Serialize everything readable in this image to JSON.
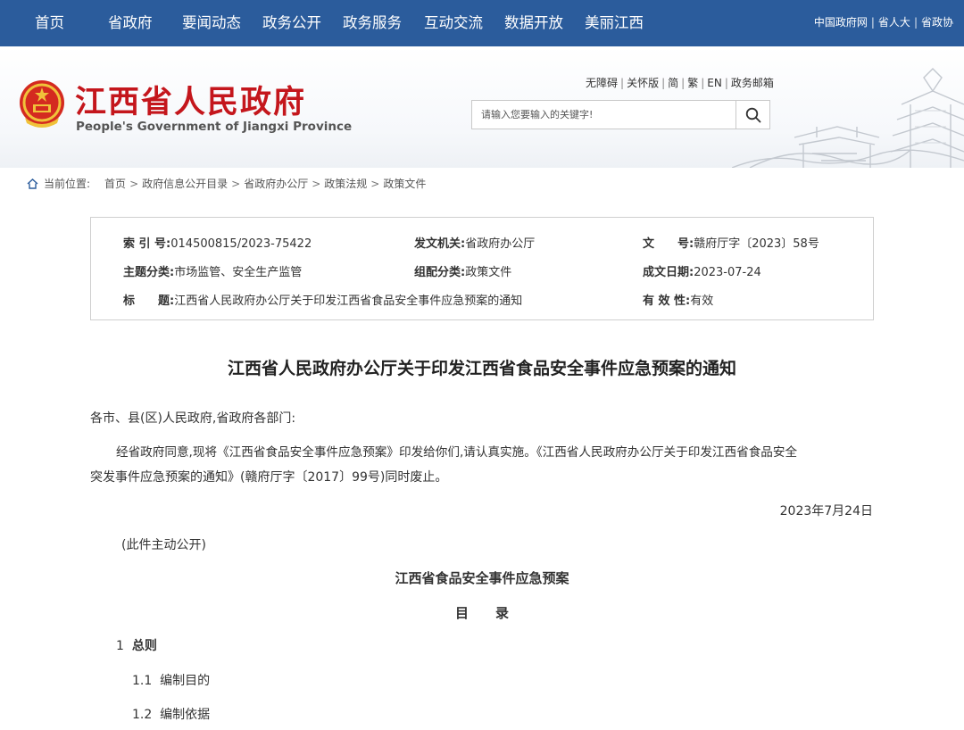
{
  "topnav": {
    "items": [
      "首页",
      "省政府",
      "要闻动态",
      "政务公开",
      "政务服务",
      "互动交流",
      "数据开放",
      "美丽江西"
    ],
    "links": [
      "中国政府网",
      "省人大",
      "省政协"
    ]
  },
  "header": {
    "title": "江西省人民政府",
    "subtitle": "People's Government of Jiangxi Province",
    "mini_links": [
      "无障碍",
      "关怀版",
      "简",
      "繁",
      "EN",
      "政务邮箱"
    ],
    "search_placeholder": "请输入您要输入的关键字!"
  },
  "breadcrumb": {
    "label": "当前位置:",
    "items": [
      "首页",
      "政府信息公开目录",
      "省政府办公厅",
      "政策法规",
      "政策文件"
    ]
  },
  "info": {
    "index_key": "索 引 号:",
    "index_val": "014500815/2023-75422",
    "issuer_key": "发文机关:",
    "issuer_val": "省政府办公厅",
    "docno_key": "文　　号:",
    "docno_val": "赣府厅字〔2023〕58号",
    "topic_key": "主题分类:",
    "topic_val": "市场监管、安全生产监管",
    "category_key": "组配分类:",
    "category_val": "政策文件",
    "date_key": "成文日期:",
    "date_val": "2023-07-24",
    "title_key": "标　　题:",
    "title_val": "江西省人民政府办公厅关于印发江西省食品安全事件应急预案的通知",
    "validity_key": "有 效 性:",
    "validity_val": "有效"
  },
  "article": {
    "title": "江西省人民政府办公厅关于印发江西省食品安全事件应急预案的通知",
    "salutation": "各市、县(区)人民政府,省政府各部门:",
    "body_line1": "经省政府同意,现将《江西省食品安全事件应急预案》印发给你们,请认真实施。《江西省人民政府办公厅关于印发江西省食品安全",
    "body_line2": "突发事件应急预案的通知》(赣府厅字〔2017〕99号)同时废止。",
    "date": "2023年7月24日",
    "note": "(此件主动公开)",
    "plan_title": "江西省食品安全事件应急预案",
    "toc_title": "目　　录",
    "toc": [
      {
        "num": "1",
        "text": "总则"
      },
      {
        "num": "1.1",
        "text": "编制目的"
      },
      {
        "num": "1.2",
        "text": "编制依据"
      }
    ]
  }
}
